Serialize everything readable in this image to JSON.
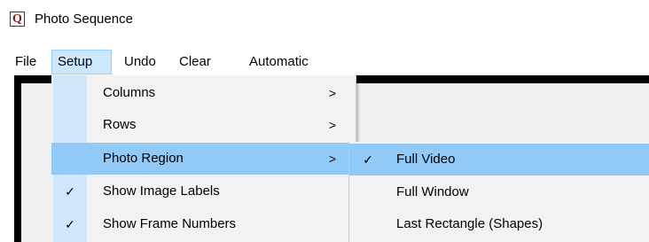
{
  "window": {
    "title": "Photo Sequence",
    "icon_letter": "Q"
  },
  "menubar": {
    "items": [
      "File",
      "Setup",
      "Undo",
      "Clear",
      "Automatic"
    ]
  },
  "setup_menu": {
    "items": [
      {
        "label": "Columns",
        "submenu": true,
        "checked": false,
        "arrow": ">"
      },
      {
        "label": "Rows",
        "submenu": true,
        "checked": false,
        "arrow": ">"
      },
      {
        "label": "Photo Region",
        "submenu": true,
        "checked": false,
        "arrow": ">"
      },
      {
        "label": "Show Image Labels",
        "submenu": false,
        "checked": true,
        "check": "✓"
      },
      {
        "label": "Show Frame Numbers",
        "submenu": false,
        "checked": true,
        "check": "✓"
      }
    ]
  },
  "photo_region_submenu": {
    "items": [
      {
        "label": "Full Video",
        "checked": true,
        "check": "✓"
      },
      {
        "label": "Full Window",
        "checked": false
      },
      {
        "label": "Last Rectangle (Shapes)",
        "checked": false
      }
    ]
  },
  "colors": {
    "highlight": "#91c9f7",
    "menu_bg": "#f2f2f2",
    "active_menu": "#cce8ff"
  }
}
